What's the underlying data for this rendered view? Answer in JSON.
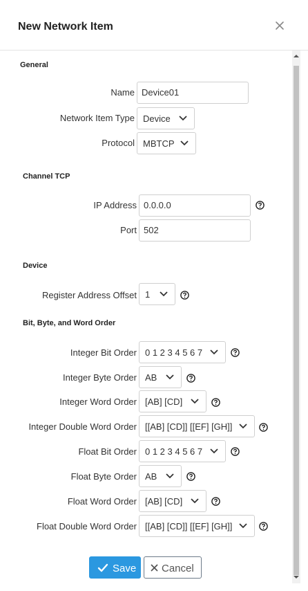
{
  "dialog": {
    "title": "New Network Item",
    "close_icon": "close-icon"
  },
  "general": {
    "heading": "General",
    "name_label": "Name",
    "name_value": "Device01",
    "type_label": "Network Item Type",
    "type_value": "Device",
    "protocol_label": "Protocol",
    "protocol_value": "MBTCP"
  },
  "channel": {
    "heading": "Channel TCP",
    "ip_label": "IP Address",
    "ip_value": "0.0.0.0",
    "port_label": "Port",
    "port_value": "502"
  },
  "device": {
    "heading": "Device",
    "offset_label": "Register Address Offset",
    "offset_value": "1"
  },
  "order": {
    "heading": "Bit, Byte, and Word Order",
    "rows": [
      {
        "label": "Integer Bit Order",
        "value": "0 1 2 3 4 5 6 7"
      },
      {
        "label": "Integer Byte Order",
        "value": "AB"
      },
      {
        "label": "Integer Word Order",
        "value": "[AB] [CD]"
      },
      {
        "label": "Integer Double Word Order",
        "value": "[[AB] [CD]] [[EF] [GH]]"
      },
      {
        "label": "Float Bit Order",
        "value": "0 1 2 3 4 5 6 7"
      },
      {
        "label": "Float Byte Order",
        "value": "AB"
      },
      {
        "label": "Float Word Order",
        "value": "[AB] [CD]"
      },
      {
        "label": "Float Double Word Order",
        "value": "[[AB] [CD]] [[EF] [GH]]"
      }
    ]
  },
  "footer": {
    "save_label": "Save",
    "cancel_label": "Cancel"
  },
  "colors": {
    "accent": "#2b98e0",
    "border": "#cfcfcf"
  }
}
